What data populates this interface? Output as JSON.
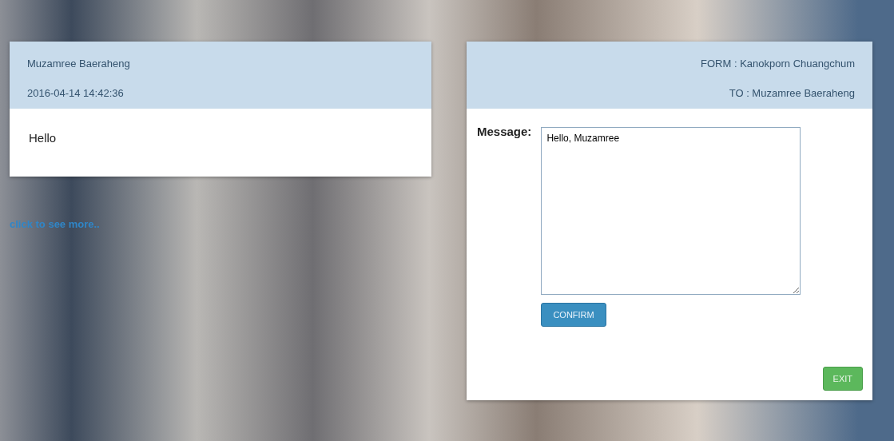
{
  "message_card": {
    "sender": "Muzamree Baeraheng",
    "timestamp": "2016-04-14 14:42:36",
    "body": "Hello"
  },
  "more_link": "click to see more..",
  "reply_form": {
    "from": "FORM : Kanokporn Chuangchum",
    "to": "TO : Muzamree Baeraheng",
    "message_label": "Message:",
    "message_value": "Hello, Muzamree",
    "confirm_button": "CONFIRM",
    "exit_button": "EXIT"
  }
}
